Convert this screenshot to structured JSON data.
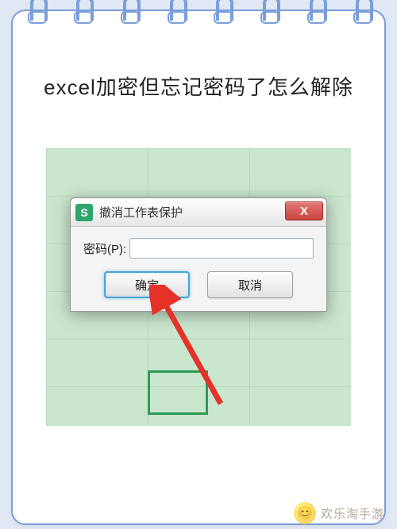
{
  "page": {
    "title": "excel加密但忘记密码了怎么解除"
  },
  "dialog": {
    "icon_letter": "S",
    "title": "撤消工作表保护",
    "close_symbol": "X",
    "password_label": "密码(P):",
    "ok_label": "确定",
    "cancel_label": "取消"
  },
  "watermark": {
    "text": "欢乐淘手游"
  }
}
